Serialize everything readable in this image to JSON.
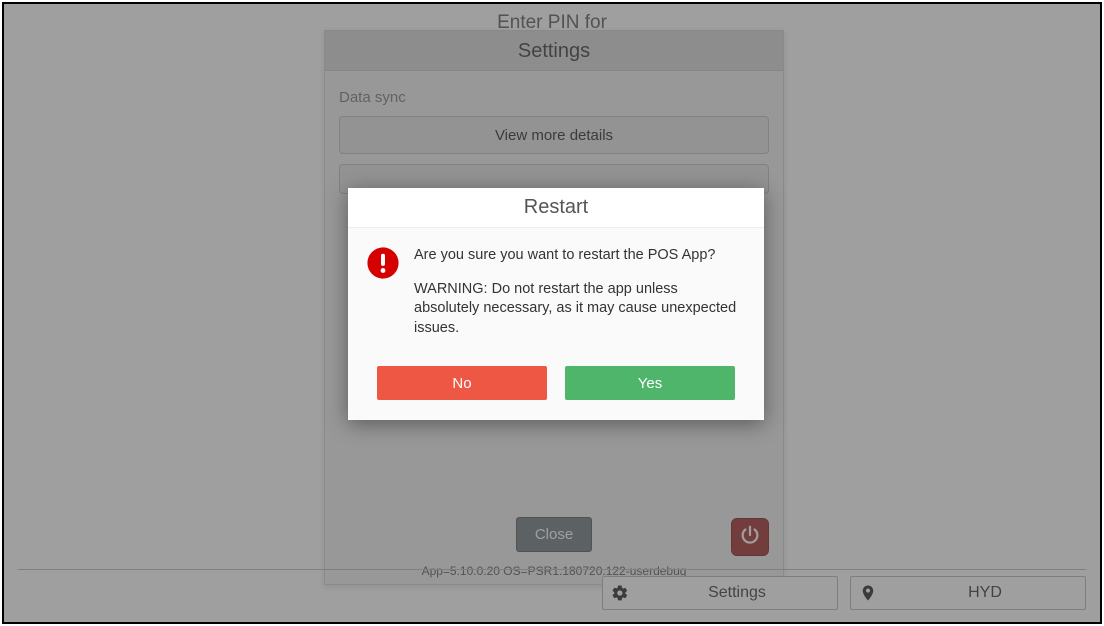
{
  "pin_prompt_title": "Enter PIN for",
  "settings_panel": {
    "title": "Settings",
    "section_data_sync": "Data sync",
    "view_more_button": "View more details",
    "close_button": "Close",
    "app_info": "App=5.10.0.20 OS=PSR1.180720.122-userdebug"
  },
  "bottom_bar": {
    "settings_label": "Settings",
    "location_label": "HYD"
  },
  "restart_dialog": {
    "title": "Restart",
    "question": "Are you sure you want to restart the POS App?",
    "warning": "WARNING: Do not restart the app unless absolutely necessary, as it may cause unexpected issues.",
    "no_label": "No",
    "yes_label": "Yes"
  }
}
